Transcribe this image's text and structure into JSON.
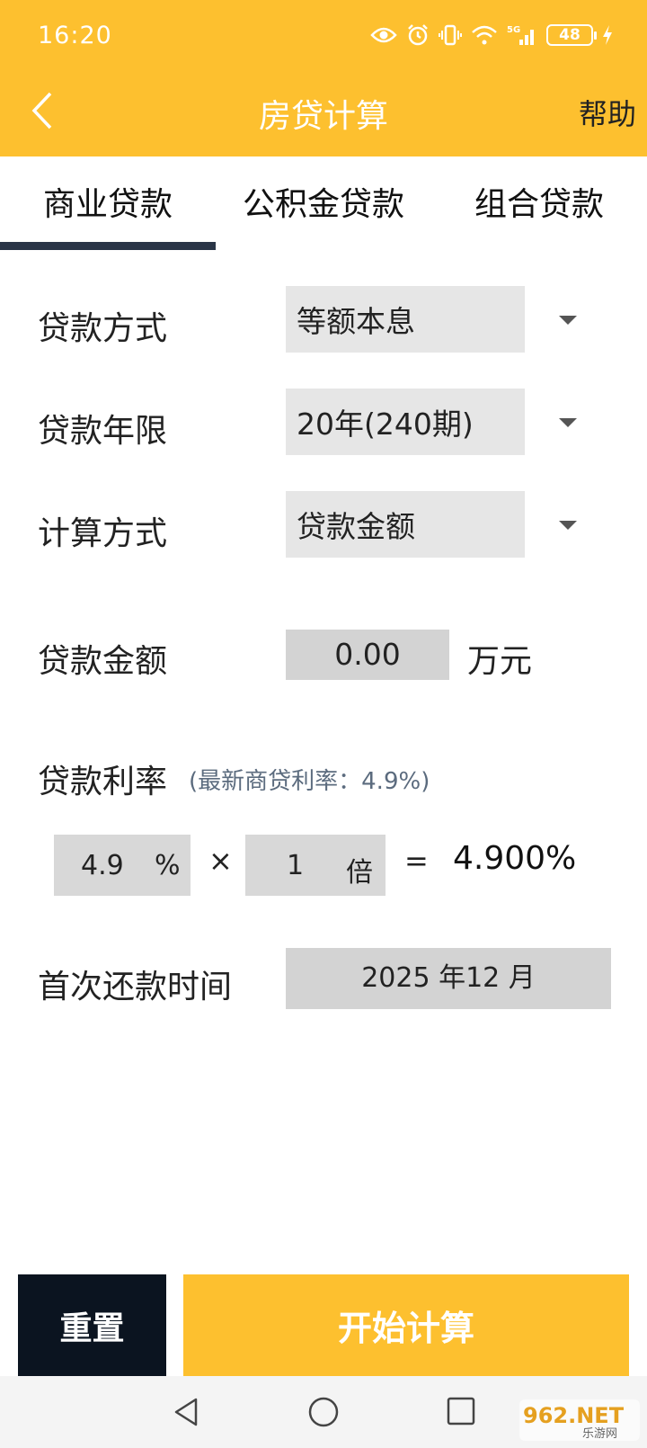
{
  "status": {
    "time": "16:20",
    "battery": "48"
  },
  "header": {
    "title": "房贷计算",
    "help": "帮助"
  },
  "tabs": [
    {
      "label": "商业贷款",
      "active": true
    },
    {
      "label": "公积金贷款",
      "active": false
    },
    {
      "label": "组合贷款",
      "active": false
    }
  ],
  "form": {
    "loan_method": {
      "label": "贷款方式",
      "value": "等额本息"
    },
    "loan_term": {
      "label": "贷款年限",
      "value": "20年(240期)"
    },
    "calc_method": {
      "label": "计算方式",
      "value": "贷款金额"
    },
    "loan_amount": {
      "label": "贷款金额",
      "value": "0.00",
      "unit": "万元"
    },
    "rate": {
      "label": "贷款利率",
      "note": "(最新商贷利率：4.9%)",
      "base_value": "4.9",
      "base_unit": "%",
      "times_symbol": "×",
      "multiplier_value": "1",
      "multiplier_unit": "倍",
      "equals_symbol": "=",
      "result": "4.900%"
    },
    "first_payment": {
      "label": "首次还款时间",
      "value": "2025 年12 月"
    }
  },
  "buttons": {
    "reset": "重置",
    "calculate": "开始计算"
  },
  "watermark": {
    "text_top": "962.NET",
    "text_bottom": "乐游网"
  },
  "colors": {
    "accent": "#FDC02F",
    "dark": "#0B1420",
    "tab_indicator": "#2A3547"
  }
}
